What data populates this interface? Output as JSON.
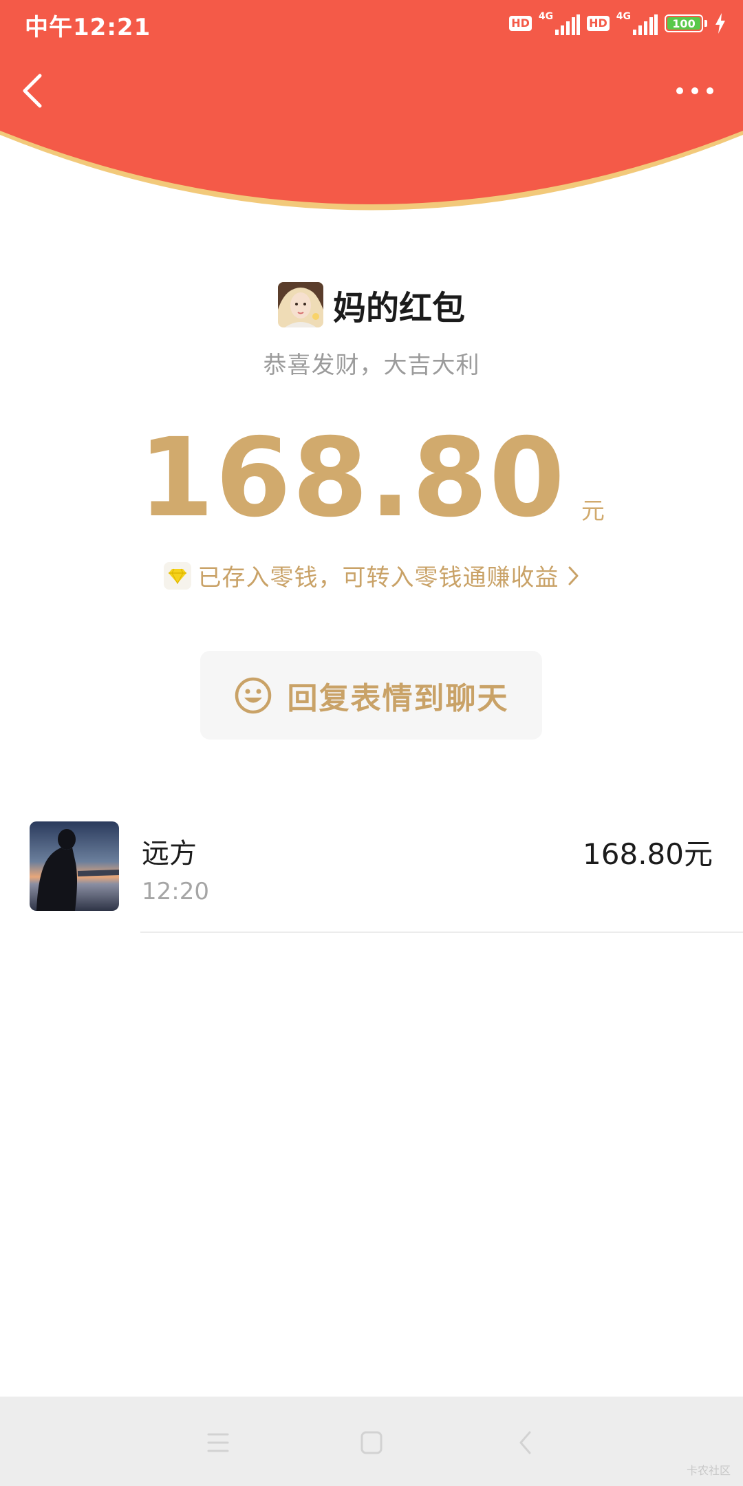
{
  "status_bar": {
    "time": "中午12:21",
    "hd_label": "HD",
    "network_label": "4G",
    "battery_level": "100",
    "battery_percent": 100,
    "icons": [
      "hd-icon",
      "signal-icon",
      "hd-icon",
      "signal-icon",
      "battery-icon",
      "charging-icon"
    ]
  },
  "header": {
    "back_icon": "chevron-left-icon",
    "more_icon": "more-dots-icon",
    "color": "#f45a48",
    "edge_color": "#f2c97a"
  },
  "packet": {
    "sender_title": "妈的红包",
    "greeting": "恭喜发财，大吉大利",
    "amount": "168.80",
    "unit": "元",
    "deposit_text": "已存入零钱，可转入零钱通赚收益",
    "deposit_icon": "diamond-icon",
    "accent_color": "#d1aa6d"
  },
  "reply": {
    "label": "回复表情到聊天",
    "icon": "smiley-icon"
  },
  "receivers": [
    {
      "name": "远方",
      "time": "12:20",
      "amount": "168.80元"
    }
  ],
  "bottom_nav": {
    "icons": [
      "menu-icon",
      "home-square-icon",
      "back-icon"
    ]
  },
  "watermark": "卡农社区"
}
